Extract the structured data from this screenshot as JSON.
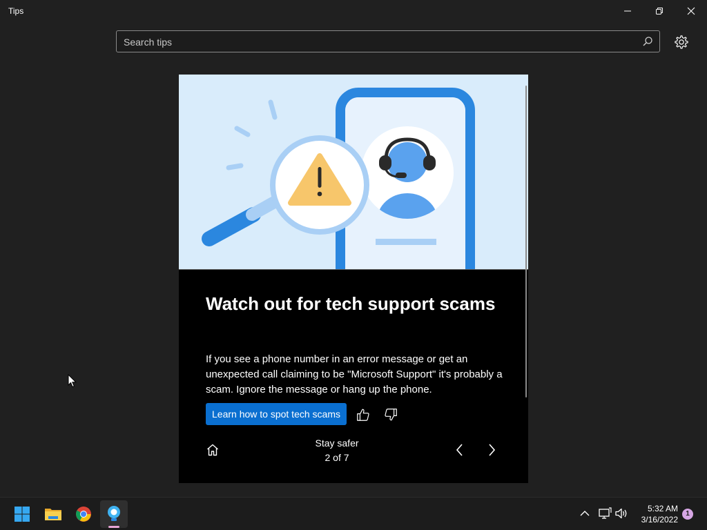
{
  "window": {
    "title": "Tips"
  },
  "search": {
    "placeholder": "Search tips",
    "icon": "search-icon"
  },
  "card": {
    "title": "Watch out for tech support scams",
    "body": "If you see a phone number in an error message or get an unexpected call claiming to be \"Microsoft Support\" it's probably a scam. Ignore the message or hang up the phone.",
    "cta_label": "Learn how to spot tech scams",
    "hero_illustration": "magnifier-warning-and-support-agent-phone",
    "colors": {
      "accent": "#0a6fd0",
      "hero_bg": "#d9ecfb",
      "card_bg": "#000000"
    }
  },
  "navigation": {
    "section": "Stay safer",
    "position": "2 of 7"
  },
  "taskbar": {
    "apps": [
      "start-icon",
      "file-explorer-icon",
      "chrome-icon",
      "tips-icon"
    ],
    "active_app": "tips-icon",
    "clock_time": "5:32 AM",
    "clock_date": "3/16/2022",
    "notification_count": "1"
  }
}
